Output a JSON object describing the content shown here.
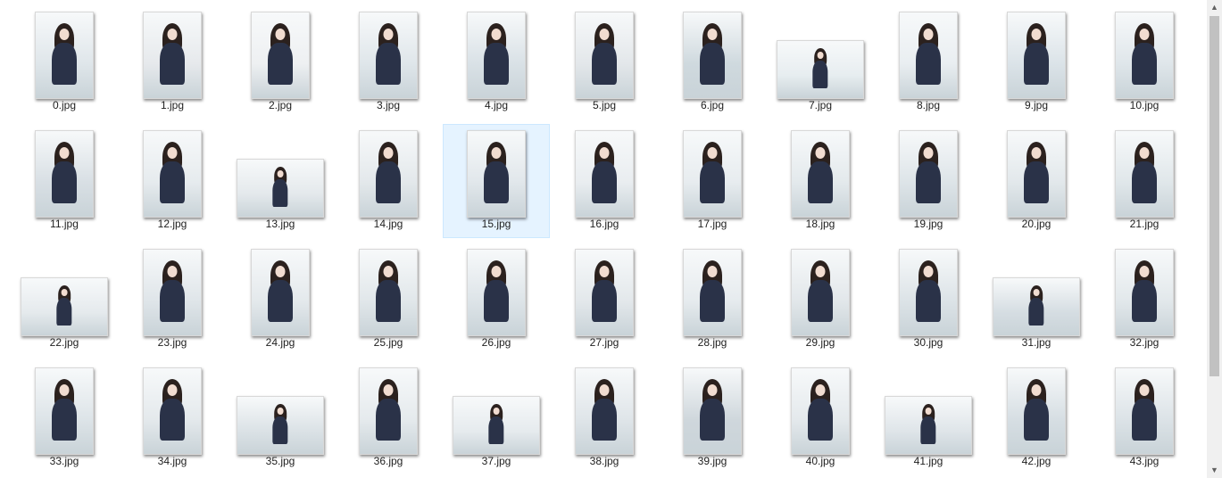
{
  "files": [
    {
      "name": "0.jpg",
      "orientation": "portrait",
      "tone": "#dfe6ea"
    },
    {
      "name": "1.jpg",
      "orientation": "portrait",
      "tone": "#e6e9ec"
    },
    {
      "name": "2.jpg",
      "orientation": "portrait",
      "tone": "#eef0f2"
    },
    {
      "name": "3.jpg",
      "orientation": "portrait",
      "tone": "#dfe6ea"
    },
    {
      "name": "4.jpg",
      "orientation": "portrait",
      "tone": "#d9e1e6"
    },
    {
      "name": "5.jpg",
      "orientation": "portrait",
      "tone": "#e3e7ea"
    },
    {
      "name": "6.jpg",
      "orientation": "portrait",
      "tone": "#cfd9de"
    },
    {
      "name": "7.jpg",
      "orientation": "landscape",
      "tone": "#e7edf0"
    },
    {
      "name": "8.jpg",
      "orientation": "portrait",
      "tone": "#e9eef1"
    },
    {
      "name": "9.jpg",
      "orientation": "portrait",
      "tone": "#dbe3e8"
    },
    {
      "name": "10.jpg",
      "orientation": "portrait",
      "tone": "#dfe6ea"
    },
    {
      "name": "11.jpg",
      "orientation": "portrait",
      "tone": "#d8dfe4"
    },
    {
      "name": "12.jpg",
      "orientation": "portrait",
      "tone": "#e6ebee"
    },
    {
      "name": "13.jpg",
      "orientation": "landscape",
      "tone": "#e4e9ec"
    },
    {
      "name": "14.jpg",
      "orientation": "portrait",
      "tone": "#e3e8eb"
    },
    {
      "name": "15.jpg",
      "orientation": "portrait",
      "tone": "#e1e7eb"
    },
    {
      "name": "16.jpg",
      "orientation": "portrait",
      "tone": "#e9edf0"
    },
    {
      "name": "17.jpg",
      "orientation": "portrait",
      "tone": "#e7ecef"
    },
    {
      "name": "18.jpg",
      "orientation": "portrait",
      "tone": "#e3e9ec"
    },
    {
      "name": "19.jpg",
      "orientation": "portrait",
      "tone": "#dde4e8"
    },
    {
      "name": "20.jpg",
      "orientation": "portrait",
      "tone": "#e2e8eb"
    },
    {
      "name": "21.jpg",
      "orientation": "portrait",
      "tone": "#e0e7ea"
    },
    {
      "name": "22.jpg",
      "orientation": "landscape",
      "tone": "#e5eaed"
    },
    {
      "name": "23.jpg",
      "orientation": "portrait",
      "tone": "#dfe5e9"
    },
    {
      "name": "24.jpg",
      "orientation": "portrait",
      "tone": "#e4e9ec"
    },
    {
      "name": "25.jpg",
      "orientation": "portrait",
      "tone": "#e1e7ea"
    },
    {
      "name": "26.jpg",
      "orientation": "portrait",
      "tone": "#dde4e8"
    },
    {
      "name": "27.jpg",
      "orientation": "portrait",
      "tone": "#e3e8eb"
    },
    {
      "name": "28.jpg",
      "orientation": "portrait",
      "tone": "#e6ebee"
    },
    {
      "name": "29.jpg",
      "orientation": "portrait",
      "tone": "#e2e7ea"
    },
    {
      "name": "30.jpg",
      "orientation": "portrait",
      "tone": "#dce3e7"
    },
    {
      "name": "31.jpg",
      "orientation": "landscape",
      "tone": "#d5dde2"
    },
    {
      "name": "32.jpg",
      "orientation": "portrait",
      "tone": "#e2e8eb"
    },
    {
      "name": "33.jpg",
      "orientation": "portrait",
      "tone": "#dde4e8"
    },
    {
      "name": "34.jpg",
      "orientation": "portrait",
      "tone": "#e4e9ec"
    },
    {
      "name": "35.jpg",
      "orientation": "landscape",
      "tone": "#dbe2e6"
    },
    {
      "name": "36.jpg",
      "orientation": "portrait",
      "tone": "#e5eaed"
    },
    {
      "name": "37.jpg",
      "orientation": "landscape",
      "tone": "#e6ebee"
    },
    {
      "name": "38.jpg",
      "orientation": "portrait",
      "tone": "#dfe5e9"
    },
    {
      "name": "39.jpg",
      "orientation": "portrait",
      "tone": "#cfd7dc"
    },
    {
      "name": "40.jpg",
      "orientation": "portrait",
      "tone": "#e4e9ec"
    },
    {
      "name": "41.jpg",
      "orientation": "landscape",
      "tone": "#dfe5e9"
    },
    {
      "name": "42.jpg",
      "orientation": "portrait",
      "tone": "#d6dee3"
    },
    {
      "name": "43.jpg",
      "orientation": "portrait",
      "tone": "#dce3e7"
    }
  ],
  "selected_index": 15,
  "colors": {
    "selection_bg": "#e5f3ff",
    "selection_border": "#cce8ff",
    "uniform": "#2a3248",
    "hair": "#2b211e",
    "skin": "#f1dcd0"
  },
  "scrollbar": {
    "up_icon": "▲",
    "down_icon": "▼"
  }
}
